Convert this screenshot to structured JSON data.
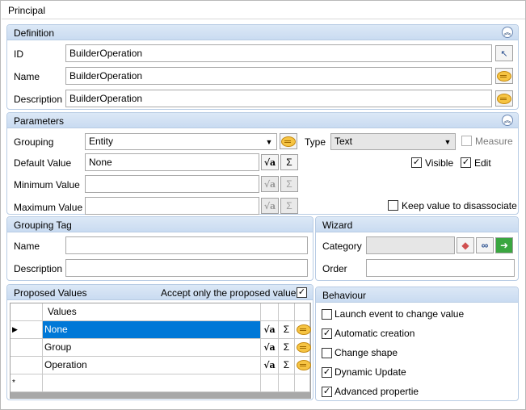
{
  "tab": {
    "title": "Principal"
  },
  "definition": {
    "title": "Definition",
    "id_label": "ID",
    "id_value": "BuilderOperation",
    "name_label": "Name",
    "name_value": "BuilderOperation",
    "description_label": "Description",
    "description_value": "BuilderOperation"
  },
  "parameters": {
    "title": "Parameters",
    "grouping_label": "Grouping",
    "grouping_value": "Entity",
    "default_label": "Default Value",
    "default_value": "None",
    "min_label": "Minimum Value",
    "min_value": "",
    "max_label": "Maximum Value",
    "max_value": "",
    "type_label": "Type",
    "type_value": "Text",
    "measure_label": "Measure",
    "visible_label": "Visible",
    "edit_label": "Edit",
    "keep_label": "Keep value to disassociate",
    "sigma": "Σ"
  },
  "grouping_tag": {
    "title": "Grouping Tag",
    "name_label": "Name",
    "name_value": "",
    "description_label": "Description",
    "description_value": ""
  },
  "wizard": {
    "title": "Wizard",
    "category_label": "Category",
    "category_value": "",
    "order_label": "Order",
    "order_value": ""
  },
  "proposed": {
    "title": "Proposed Values",
    "accept_label": "Accept only the proposed values",
    "column_header": "Values",
    "rows": [
      "None",
      "Group",
      "Operation"
    ],
    "row_marker": "▶",
    "new_marker": "*",
    "sigma": "Σ"
  },
  "behaviour": {
    "title": "Behaviour",
    "items": [
      "Launch event to change value",
      "Automatic creation",
      "Change shape",
      "Dynamic Update",
      "Advanced propertie"
    ],
    "checked": [
      false,
      true,
      false,
      true,
      true
    ]
  },
  "colors": {
    "header": "#c9dbf1",
    "selection": "#0078d7",
    "border": "#b8cce4"
  }
}
